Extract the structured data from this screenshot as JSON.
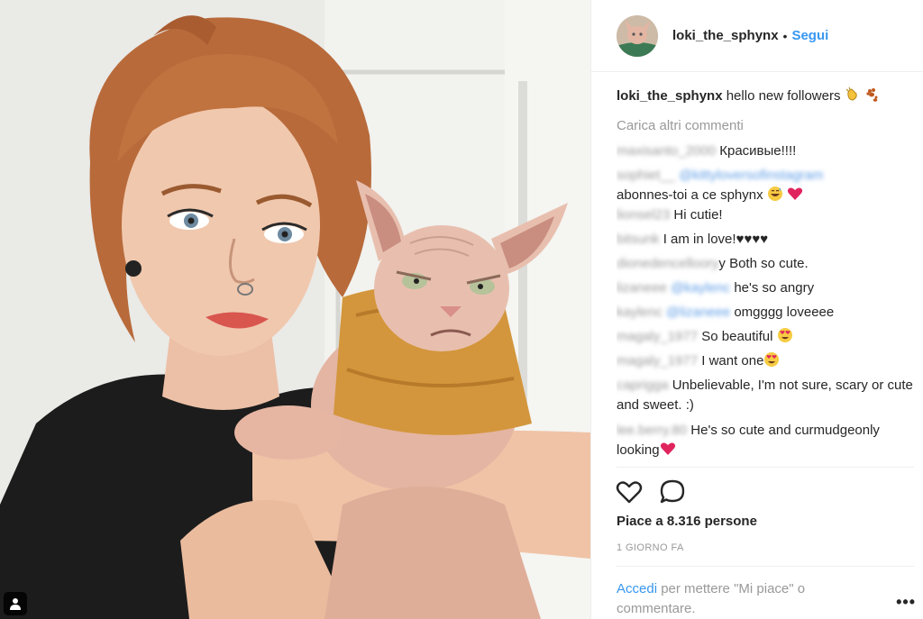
{
  "post": {
    "username": "loki_the_sphynx",
    "separator": "•",
    "follow_label": "Segui",
    "caption_text": "hello new followers",
    "load_more": "Carica altri commenti",
    "likes": "Piace a 8.316 persone",
    "time_ago": "1 GIORNO FA",
    "login_link": "Accedi",
    "login_text": "per mettere \"Mi piace\" o commentare.",
    "more_options": "•••"
  },
  "comments": [
    {
      "user": "maxisanto_2000",
      "text": "Красивые!!!!"
    },
    {
      "user": "sophiet__",
      "mention": "@kittyloversofinstagram",
      "text": "abonnes-toi a ce sphynx",
      "emoji": [
        "grin-sweat",
        "heart"
      ]
    },
    {
      "user": "lionsel23",
      "text": "Hi cutie!"
    },
    {
      "user": "bitsunk",
      "text": "I am in love!♥♥♥♥"
    },
    {
      "user": "dionedencelloory",
      "text": "y Both so cute."
    },
    {
      "user": "lizaneee",
      "mention": "@kaylenc",
      "text": "he's so angry"
    },
    {
      "user": "kaylenc",
      "mention": "@lizaneee",
      "text": "omgggg loveeee"
    },
    {
      "user": "magaly_1977",
      "text": "So beautiful",
      "emoji": [
        "heart-eyes"
      ]
    },
    {
      "user": "magaly_1977",
      "text": "I want one",
      "emoji": [
        "heart-eyes"
      ]
    },
    {
      "user": "caprigga",
      "text": "Unbelievable, I'm not sure, scary or cute and sweet. :)"
    },
    {
      "user": "lee.berry.80",
      "text": "He's so cute and curmudgeonly looking",
      "emoji": [
        "heart"
      ]
    }
  ],
  "icons": {
    "like": "heart-outline-icon",
    "comment": "speech-bubble-icon",
    "tag": "person-tag-icon",
    "caption_emoji": [
      "clapping-hands-icon",
      "paw-prints-icon"
    ]
  },
  "colors": {
    "link_blue": "#3897f0",
    "text": "#262626",
    "muted": "#999999",
    "heart_red": "#e0245e"
  }
}
